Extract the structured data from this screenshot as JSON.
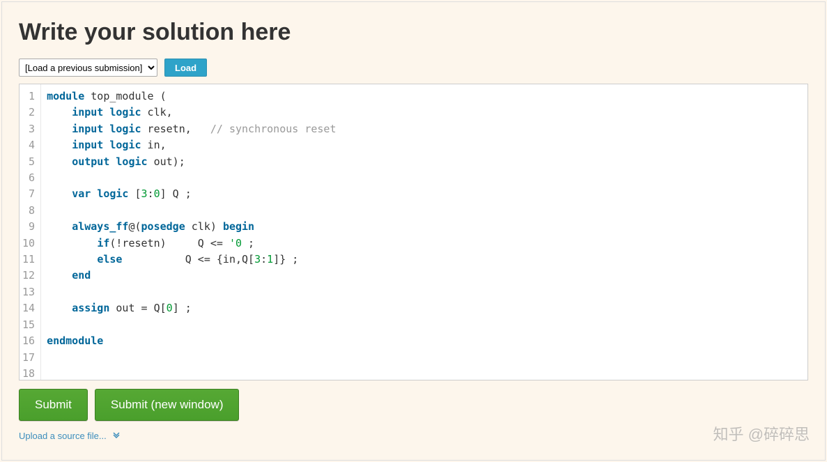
{
  "heading": "Write your solution here",
  "toolbar": {
    "select_value": "[Load a previous submission]",
    "load_label": "Load"
  },
  "code": {
    "line_count": 18,
    "lines": [
      {
        "n": 1,
        "tokens": [
          [
            "kw",
            "module"
          ],
          [
            "",
            " top_module ("
          ]
        ]
      },
      {
        "n": 2,
        "tokens": [
          [
            "",
            "    "
          ],
          [
            "kw",
            "input"
          ],
          [
            "",
            " "
          ],
          [
            "kw",
            "logic"
          ],
          [
            "",
            " clk,"
          ]
        ]
      },
      {
        "n": 3,
        "tokens": [
          [
            "",
            "    "
          ],
          [
            "kw",
            "input"
          ],
          [
            "",
            " "
          ],
          [
            "kw",
            "logic"
          ],
          [
            "",
            " resetn,   "
          ],
          [
            "cmt",
            "// synchronous reset"
          ]
        ]
      },
      {
        "n": 4,
        "tokens": [
          [
            "",
            "    "
          ],
          [
            "kw",
            "input"
          ],
          [
            "",
            " "
          ],
          [
            "kw",
            "logic"
          ],
          [
            "",
            " in,"
          ]
        ]
      },
      {
        "n": 5,
        "tokens": [
          [
            "",
            "    "
          ],
          [
            "kw",
            "output"
          ],
          [
            "",
            " "
          ],
          [
            "kw",
            "logic"
          ],
          [
            "",
            " out);"
          ]
        ]
      },
      {
        "n": 6,
        "tokens": []
      },
      {
        "n": 7,
        "tokens": [
          [
            "",
            "    "
          ],
          [
            "kw",
            "var"
          ],
          [
            "",
            " "
          ],
          [
            "kw",
            "logic"
          ],
          [
            "",
            " ["
          ],
          [
            "num",
            "3"
          ],
          [
            "",
            ":"
          ],
          [
            "num",
            "0"
          ],
          [
            "",
            "] Q ;"
          ]
        ]
      },
      {
        "n": 8,
        "tokens": []
      },
      {
        "n": 9,
        "tokens": [
          [
            "",
            "    "
          ],
          [
            "kw",
            "always_ff"
          ],
          [
            "",
            "@("
          ],
          [
            "kw",
            "posedge"
          ],
          [
            "",
            " clk) "
          ],
          [
            "kw",
            "begin"
          ]
        ]
      },
      {
        "n": 10,
        "tokens": [
          [
            "",
            "        "
          ],
          [
            "kw",
            "if"
          ],
          [
            "",
            "(!resetn)     Q <= "
          ],
          [
            "num",
            "'0"
          ],
          [
            "",
            " ;"
          ]
        ]
      },
      {
        "n": 11,
        "tokens": [
          [
            "",
            "        "
          ],
          [
            "kw",
            "else"
          ],
          [
            "",
            "          Q <= {in,Q["
          ],
          [
            "num",
            "3"
          ],
          [
            "",
            ":"
          ],
          [
            "num",
            "1"
          ],
          [
            "",
            "]} ;"
          ]
        ]
      },
      {
        "n": 12,
        "tokens": [
          [
            "",
            "    "
          ],
          [
            "kw",
            "end"
          ]
        ]
      },
      {
        "n": 13,
        "tokens": []
      },
      {
        "n": 14,
        "tokens": [
          [
            "",
            "    "
          ],
          [
            "kw",
            "assign"
          ],
          [
            "",
            " out = Q["
          ],
          [
            "num",
            "0"
          ],
          [
            "",
            "] ;"
          ]
        ]
      },
      {
        "n": 15,
        "tokens": []
      },
      {
        "n": 16,
        "tokens": [
          [
            "kw",
            "endmodule"
          ]
        ]
      },
      {
        "n": 17,
        "tokens": []
      },
      {
        "n": 18,
        "tokens": []
      }
    ]
  },
  "actions": {
    "submit_label": "Submit",
    "submit_new_label": "Submit (new window)"
  },
  "upload": {
    "link_text": "Upload a source file...",
    "chevron": "»"
  },
  "watermark": "知乎 @碎碎思"
}
